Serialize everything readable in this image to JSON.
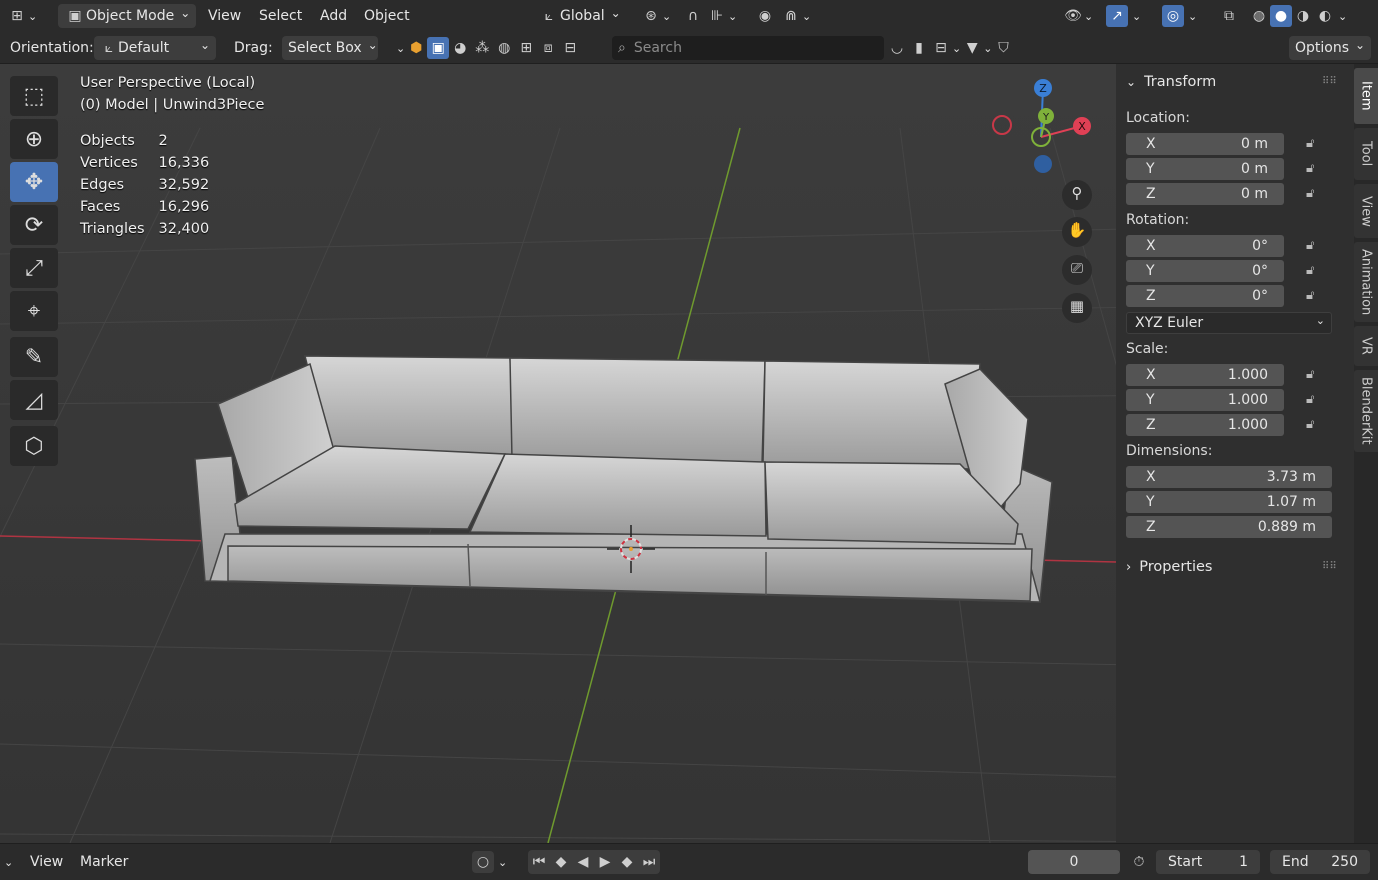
{
  "header": {
    "mode_label": "Object Mode",
    "menus": [
      "View",
      "Select",
      "Add",
      "Object"
    ],
    "transform_orientation": "Global"
  },
  "toolbar": {
    "orientation_label": "Orientation:",
    "orientation_value": "Default",
    "drag_label": "Drag:",
    "drag_value": "Select Box",
    "search_placeholder": "Search",
    "options_label": "Options"
  },
  "viewport": {
    "perspective_title": "User Perspective (Local)",
    "model_line": "(0) Model | Unwind3Piece",
    "stats": [
      {
        "label": "Objects",
        "value": "2"
      },
      {
        "label": "Vertices",
        "value": "16,336"
      },
      {
        "label": "Edges",
        "value": "32,592"
      },
      {
        "label": "Faces",
        "value": "16,296"
      },
      {
        "label": "Triangles",
        "value": "32,400"
      }
    ],
    "gizmo": {
      "x": "X",
      "y": "Y",
      "z": "Z"
    }
  },
  "transform_panel": {
    "title": "Transform",
    "location_label": "Location:",
    "location": [
      {
        "axis": "X",
        "value": "0 m"
      },
      {
        "axis": "Y",
        "value": "0 m"
      },
      {
        "axis": "Z",
        "value": "0 m"
      }
    ],
    "rotation_label": "Rotation:",
    "rotation": [
      {
        "axis": "X",
        "value": "0°"
      },
      {
        "axis": "Y",
        "value": "0°"
      },
      {
        "axis": "Z",
        "value": "0°"
      }
    ],
    "rotation_mode": "XYZ Euler",
    "scale_label": "Scale:",
    "scale": [
      {
        "axis": "X",
        "value": "1.000"
      },
      {
        "axis": "Y",
        "value": "1.000"
      },
      {
        "axis": "Z",
        "value": "1.000"
      }
    ],
    "dimensions_label": "Dimensions:",
    "dimensions": [
      {
        "axis": "X",
        "value": "3.73 m"
      },
      {
        "axis": "Y",
        "value": "1.07 m"
      },
      {
        "axis": "Z",
        "value": "0.889 m"
      }
    ],
    "properties_label": "Properties"
  },
  "side_tabs": [
    "Item",
    "Tool",
    "View",
    "Animation",
    "VR",
    "BlenderKit"
  ],
  "timeline": {
    "view_label": "View",
    "marker_label": "Marker",
    "current_frame": "0",
    "start_label": "Start",
    "start_value": "1",
    "end_label": "End",
    "end_value": "250"
  },
  "colors": {
    "accent": "#4772b3",
    "x_axis": "#e04055",
    "y_axis": "#7fb13a",
    "z_axis": "#3a7fd6"
  }
}
